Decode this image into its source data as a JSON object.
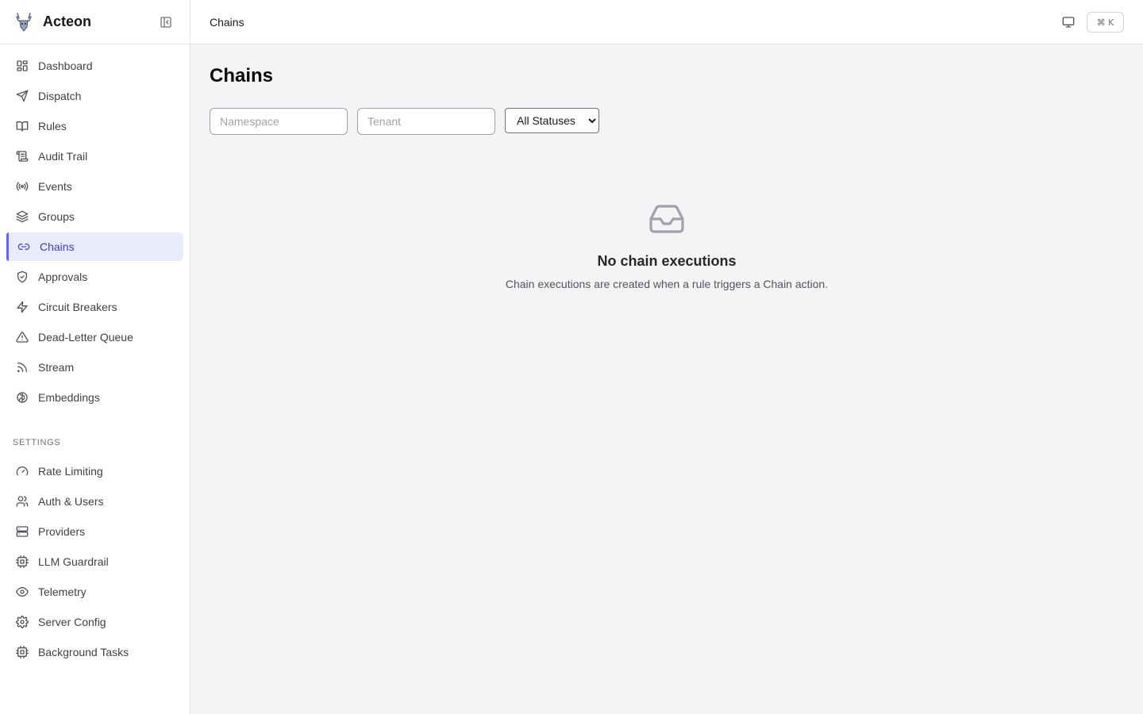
{
  "app": {
    "name": "Acteon"
  },
  "sidebar": {
    "items": [
      {
        "label": "Dashboard",
        "icon": "dashboard-icon"
      },
      {
        "label": "Dispatch",
        "icon": "send-icon"
      },
      {
        "label": "Rules",
        "icon": "book-icon"
      },
      {
        "label": "Audit Trail",
        "icon": "scroll-icon"
      },
      {
        "label": "Events",
        "icon": "radio-icon"
      },
      {
        "label": "Groups",
        "icon": "layers-icon"
      },
      {
        "label": "Chains",
        "icon": "link-icon",
        "active": true
      },
      {
        "label": "Approvals",
        "icon": "shield-check-icon"
      },
      {
        "label": "Circuit Breakers",
        "icon": "zap-icon"
      },
      {
        "label": "Dead-Letter Queue",
        "icon": "alert-triangle-icon"
      },
      {
        "label": "Stream",
        "icon": "rss-icon"
      },
      {
        "label": "Embeddings",
        "icon": "brain-icon"
      }
    ],
    "settings_title": "SETTINGS",
    "settings_items": [
      {
        "label": "Rate Limiting",
        "icon": "gauge-icon"
      },
      {
        "label": "Auth & Users",
        "icon": "users-icon"
      },
      {
        "label": "Providers",
        "icon": "server-icon"
      },
      {
        "label": "LLM Guardrail",
        "icon": "cpu-icon"
      },
      {
        "label": "Telemetry",
        "icon": "eye-icon"
      },
      {
        "label": "Server Config",
        "icon": "settings-icon"
      },
      {
        "label": "Background Tasks",
        "icon": "cpu-icon"
      }
    ]
  },
  "topbar": {
    "title": "Chains",
    "shortcut": "⌘ K"
  },
  "main": {
    "title": "Chains",
    "filters": {
      "namespace_placeholder": "Namespace",
      "tenant_placeholder": "Tenant",
      "status_selected": "All Statuses"
    },
    "empty": {
      "title": "No chain executions",
      "description": "Chain executions are created when a rule triggers a Chain action."
    }
  },
  "colors": {
    "accent": "#4f46e5",
    "active_bg": "#e9ebfb",
    "background": "#f4f4f6"
  }
}
